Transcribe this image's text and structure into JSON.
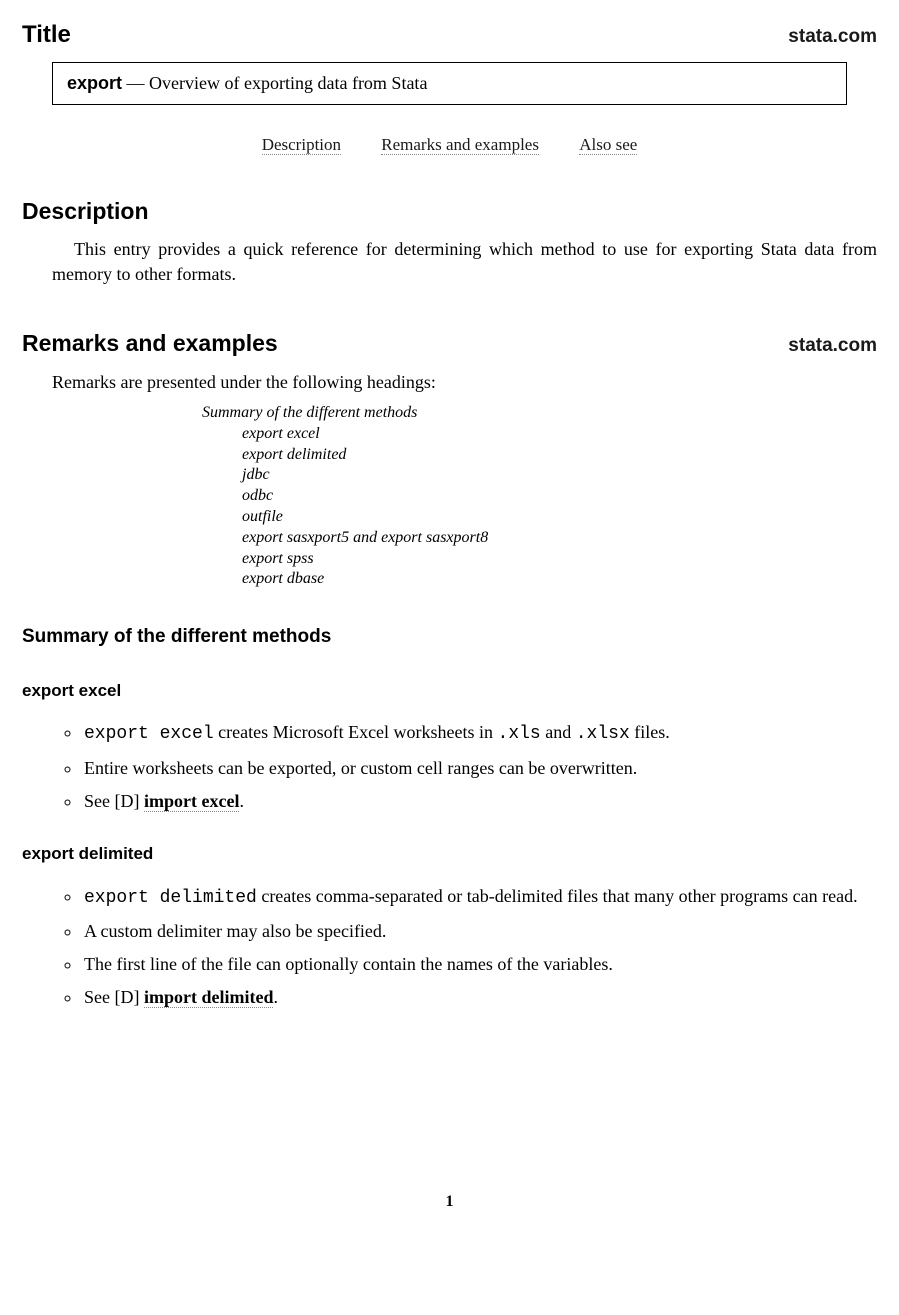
{
  "header": {
    "title": "Title",
    "site": "stata.com"
  },
  "box": {
    "cmd": "export",
    "dash": " — ",
    "subtitle": "Overview of exporting data from Stata"
  },
  "nav": {
    "desc": "Description",
    "remarks": "Remarks and examples",
    "also": "Also see"
  },
  "description": {
    "heading": "Description",
    "para": "This entry provides a quick reference for determining which method to use for exporting Stata data from memory to other formats."
  },
  "remarks": {
    "heading": "Remarks and examples",
    "site": "stata.com",
    "intro": "Remarks are presented under the following headings:",
    "headings_title": "Summary of the different methods",
    "subs": {
      "s0": "export excel",
      "s1": "export delimited",
      "s2": "jdbc",
      "s3": "odbc",
      "s4": "outfile",
      "s5": "export sasxport5 and export sasxport8",
      "s6": "export spss",
      "s7": "export dbase"
    }
  },
  "summary": {
    "heading": "Summary of the different methods"
  },
  "excel": {
    "heading": "export excel",
    "b0a": "export excel",
    "b0b": " creates Microsoft Excel worksheets in ",
    "b0c": ".xls",
    "b0d": " and ",
    "b0e": ".xlsx",
    "b0f": " files.",
    "b1": "Entire worksheets can be exported, or custom cell ranges can be overwritten.",
    "b2a": "See [",
    "b2b": "D",
    "b2c": "] ",
    "b2d": "import excel",
    "b2e": "."
  },
  "delimited": {
    "heading": "export delimited",
    "b0a": "export delimited",
    "b0b": " creates comma-separated or tab-delimited files that many other programs can read.",
    "b1": "A custom delimiter may also be specified.",
    "b2": "The first line of the file can optionally contain the names of the variables.",
    "b3a": "See [",
    "b3b": "D",
    "b3c": "] ",
    "b3d": "import delimited",
    "b3e": "."
  },
  "page": "1"
}
